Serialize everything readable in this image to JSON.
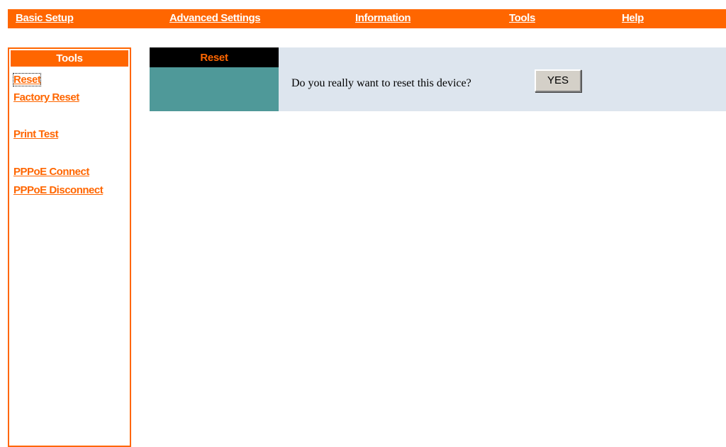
{
  "colors": {
    "accent": "#ff6600",
    "panel_bg": "#dde5ee",
    "teal": "#4f9999",
    "header_bg": "#000000"
  },
  "topnav": {
    "items": [
      {
        "label": "Basic Setup"
      },
      {
        "label": "Advanced Settings"
      },
      {
        "label": "Information"
      },
      {
        "label": "Tools"
      },
      {
        "label": "Help"
      }
    ]
  },
  "sidebar": {
    "title": "Tools",
    "items": [
      {
        "label": "Reset"
      },
      {
        "label": "Factory Reset"
      },
      {
        "label": "Print Test"
      },
      {
        "label": "PPPoE Connect"
      },
      {
        "label": "PPPoE Disconnect"
      }
    ]
  },
  "main": {
    "section_title": "Reset",
    "question": "Do you really want to reset this device?",
    "confirm_label": "YES"
  }
}
